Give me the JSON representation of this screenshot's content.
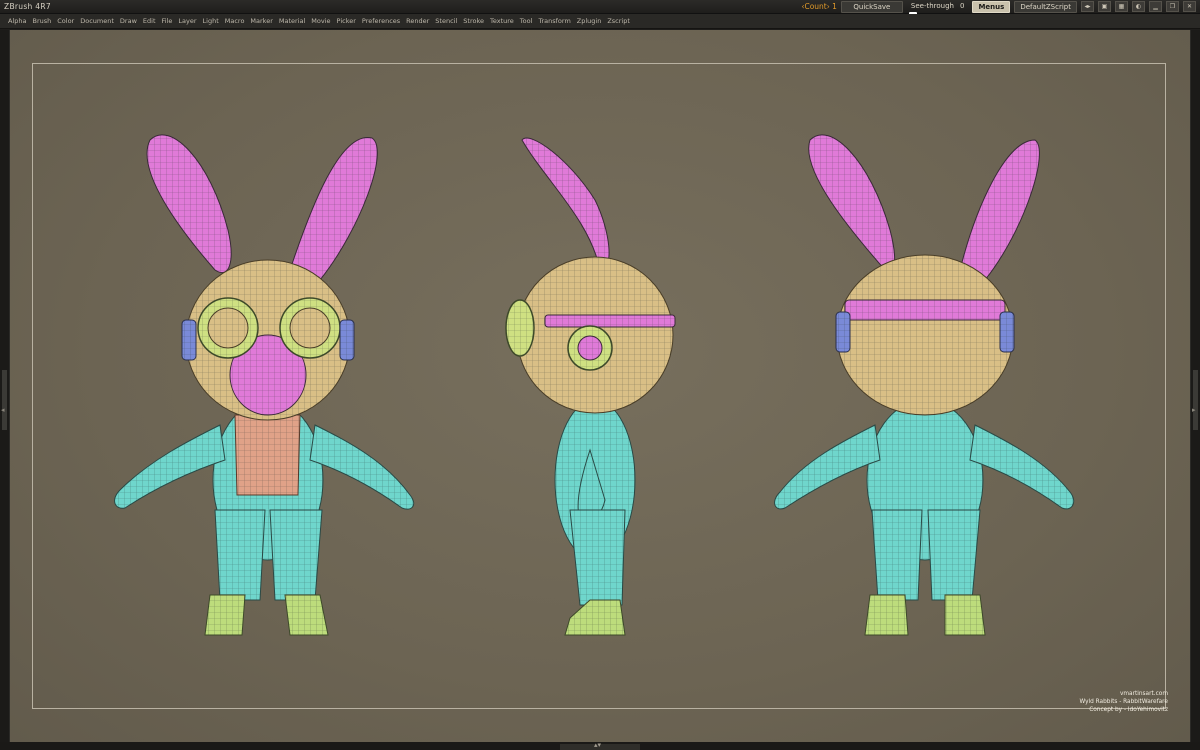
{
  "app": {
    "title": "ZBrush 4R7"
  },
  "toolbar": {
    "count_label": "‹Count› 1",
    "quicksave_label": "QuickSave",
    "seethrough_label": "See-through",
    "seethrough_value": "0",
    "menus_label": "Menus",
    "script_label": "DefaultZScript"
  },
  "menu": {
    "items": [
      "Alpha",
      "Brush",
      "Color",
      "Document",
      "Draw",
      "Edit",
      "File",
      "Layer",
      "Light",
      "Macro",
      "Marker",
      "Material",
      "Movie",
      "Picker",
      "Preferences",
      "Render",
      "Stencil",
      "Stroke",
      "Texture",
      "Tool",
      "Transform",
      "Zplugin",
      "Zscript"
    ]
  },
  "credits": {
    "line1": "vmartinsart.com",
    "line2": "Wyld Rabbits - RabbitWarefare",
    "line3": "Concept by - IdoYehimovitz"
  },
  "colors": {
    "ear": "#e07ad8",
    "head": "#d9bf86",
    "suit": "#6fd6cc",
    "bib": "#e0a288",
    "boots": "#bddc7c",
    "goggle": "#cfe082",
    "canvas": "#6f6756"
  }
}
